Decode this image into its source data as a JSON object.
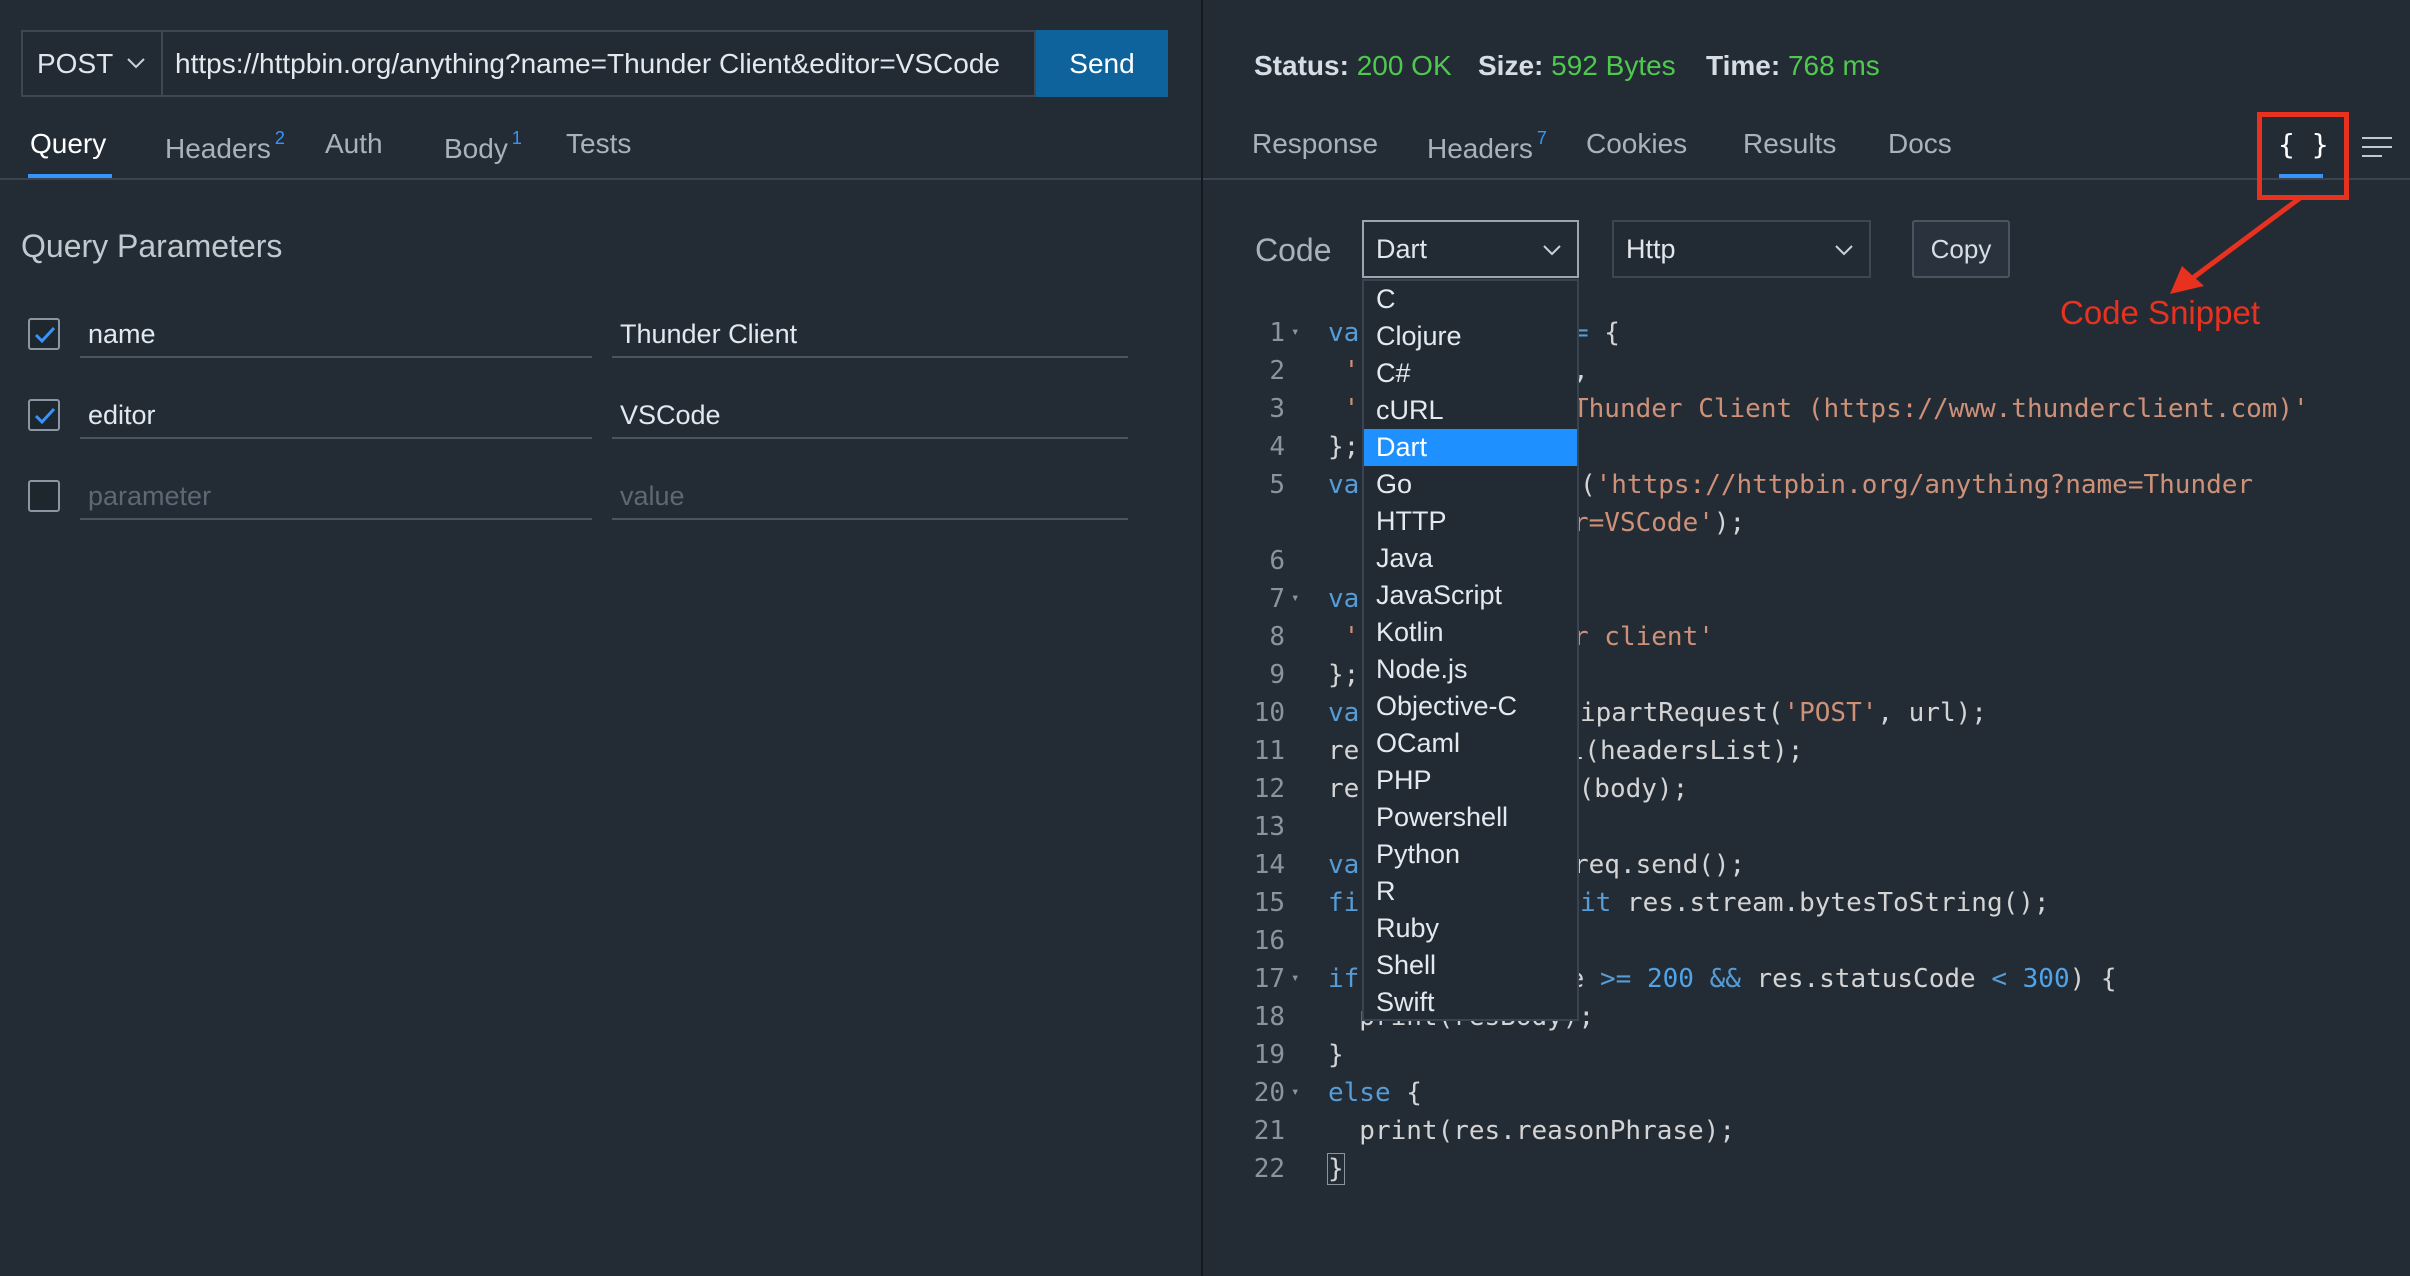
{
  "request": {
    "method": "POST",
    "url": "https://httpbin.org/anything?name=Thunder Client&editor=VSCode",
    "send_label": "Send"
  },
  "request_tabs": [
    {
      "label": "Query",
      "badge": ""
    },
    {
      "label": "Headers",
      "badge": "2"
    },
    {
      "label": "Auth",
      "badge": ""
    },
    {
      "label": "Body",
      "badge": "1"
    },
    {
      "label": "Tests",
      "badge": ""
    }
  ],
  "query": {
    "title": "Query Parameters",
    "rows": [
      {
        "checked": true,
        "key": "name",
        "value": "Thunder Client"
      },
      {
        "checked": true,
        "key": "editor",
        "value": "VSCode"
      }
    ],
    "placeholder_key": "parameter",
    "placeholder_value": "value"
  },
  "response_status": {
    "status_label": "Status:",
    "status_value": "200 OK",
    "size_label": "Size:",
    "size_value": "592 Bytes",
    "time_label": "Time:",
    "time_value": "768 ms",
    "success_color": "#4ec94e"
  },
  "response_tabs": [
    {
      "label": "Response",
      "badge": ""
    },
    {
      "label": "Headers",
      "badge": "7"
    },
    {
      "label": "Cookies",
      "badge": ""
    },
    {
      "label": "Results",
      "badge": ""
    },
    {
      "label": "Docs",
      "badge": ""
    }
  ],
  "code_snippet": {
    "icon_text": "{ }",
    "label": "Code",
    "language": "Dart",
    "client": "Http",
    "copy_label": "Copy",
    "annotation": "Code Snippet",
    "annotation_color": "#e8321f"
  },
  "language_options": [
    "C",
    "Clojure",
    "C#",
    "cURL",
    "Dart",
    "Go",
    "HTTP",
    "Java",
    "JavaScript",
    "Kotlin",
    "Node.js",
    "Objective-C",
    "OCaml",
    "PHP",
    "Powershell",
    "Python",
    "R",
    "Ruby",
    "Shell",
    "Swift"
  ],
  "selected_language": "Dart",
  "code_lines": [
    {
      "n": "1",
      "fold": true,
      "html": "<span class=\"kw\">va</span>"
    },
    {
      "n": "2",
      "fold": false,
      "html": " <span class=\"str\">'</span>"
    },
    {
      "n": "3",
      "fold": false,
      "html": " <span class=\"str\">'</span>"
    },
    {
      "n": "4",
      "fold": false,
      "html": "};"
    },
    {
      "n": "5",
      "fold": false,
      "html": "<span class=\"kw\">va</span>"
    },
    {
      "n": "6",
      "fold": false,
      "html": ""
    },
    {
      "n": "7",
      "fold": true,
      "html": "<span class=\"kw\">va</span>"
    },
    {
      "n": "8",
      "fold": false,
      "html": " <span class=\"str\">'</span>"
    },
    {
      "n": "9",
      "fold": false,
      "html": "};"
    },
    {
      "n": "10",
      "fold": false,
      "html": "<span class=\"kw\">va</span>"
    },
    {
      "n": "11",
      "fold": false,
      "html": "re"
    },
    {
      "n": "12",
      "fold": false,
      "html": "re"
    },
    {
      "n": "13",
      "fold": false,
      "html": ""
    },
    {
      "n": "14",
      "fold": false,
      "html": "<span class=\"kw\">va</span>"
    },
    {
      "n": "15",
      "fold": false,
      "html": "<span class=\"kw\">fi</span>"
    },
    {
      "n": "16",
      "fold": false,
      "html": ""
    },
    {
      "n": "17",
      "fold": true,
      "html": "<span class=\"kw\">if</span>"
    },
    {
      "n": "18",
      "fold": false,
      "html": "  print(resBody);"
    },
    {
      "n": "19",
      "fold": false,
      "html": "}"
    },
    {
      "n": "20",
      "fold": true,
      "html": "<span class=\"kw\">else</span> {"
    },
    {
      "n": "21",
      "fold": false,
      "html": "  print(res.reasonPhrase);"
    },
    {
      "n": "22",
      "fold": false,
      "html": "<span class=\"cursorbox\">}</span>"
    }
  ],
  "code_tails": [
    {
      "line": "1",
      "html": "<span class=\"op\">=</span> {"
    },
    {
      "line": "2",
      "html": ","
    },
    {
      "line": "3",
      "html": "<span class=\"str\">Thunder Client (https://www.thunderclient.com)'</span>"
    },
    {
      "line": "5",
      "html": "rse(<span class=\"str\">'https://httpbin.org/anything?name=Thunder</span>"
    },
    {
      "line": "5b",
      "html": "<span class=\"str\">r=VSCode'</span>);"
    },
    {
      "line": "8",
      "html": "<span class=\"str\">r client'</span>"
    },
    {
      "line": "10",
      "html": "ultipartRequest(<span class=\"str\">'POST'</span>, url);"
    },
    {
      "line": "11",
      "html": "ll(headersList);"
    },
    {
      "line": "12",
      "html": "l(body);"
    },
    {
      "line": "14",
      "html": "req.send();"
    },
    {
      "line": "15",
      "html": "<span class=\"kw\">await</span> res.stream.bytesToString();"
    },
    {
      "line": "17",
      "html": "de <span class=\"op\">&gt;=</span> <span class=\"num\">200</span> <span class=\"op\">&amp;&amp;</span> res.statusCode <span class=\"op\">&lt;</span> <span class=\"num\">300</span>) {"
    }
  ]
}
